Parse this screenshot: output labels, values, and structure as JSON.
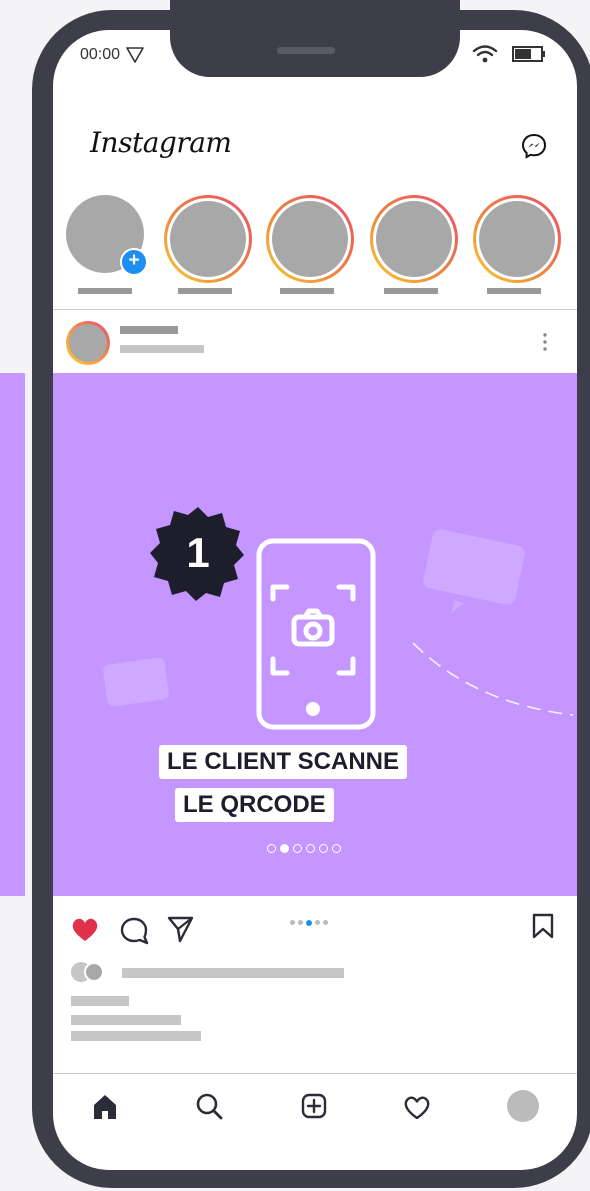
{
  "status": {
    "time": "00:00"
  },
  "app": {
    "logo": "Instagram"
  },
  "post": {
    "step_number": "1",
    "caption_line1": "LE CLIENT SCANNE",
    "caption_line2": "LE QRCODE",
    "slide_index": 2,
    "slide_count": 6
  },
  "icons": {
    "status": [
      "location-arrow-icon",
      "wifi-icon",
      "battery-icon"
    ],
    "header": [
      "messenger-icon"
    ],
    "actions": [
      "heart-icon",
      "comment-icon",
      "share-icon",
      "bookmark-icon"
    ],
    "nav": [
      "home-icon",
      "search-icon",
      "add-post-icon",
      "activity-heart-icon",
      "profile-avatar"
    ]
  },
  "colors": {
    "post_background": "#c596ff",
    "like_red": "#e0314b",
    "active_dot": "#1f8ef1",
    "phone_frame": "#3d3e4a"
  }
}
